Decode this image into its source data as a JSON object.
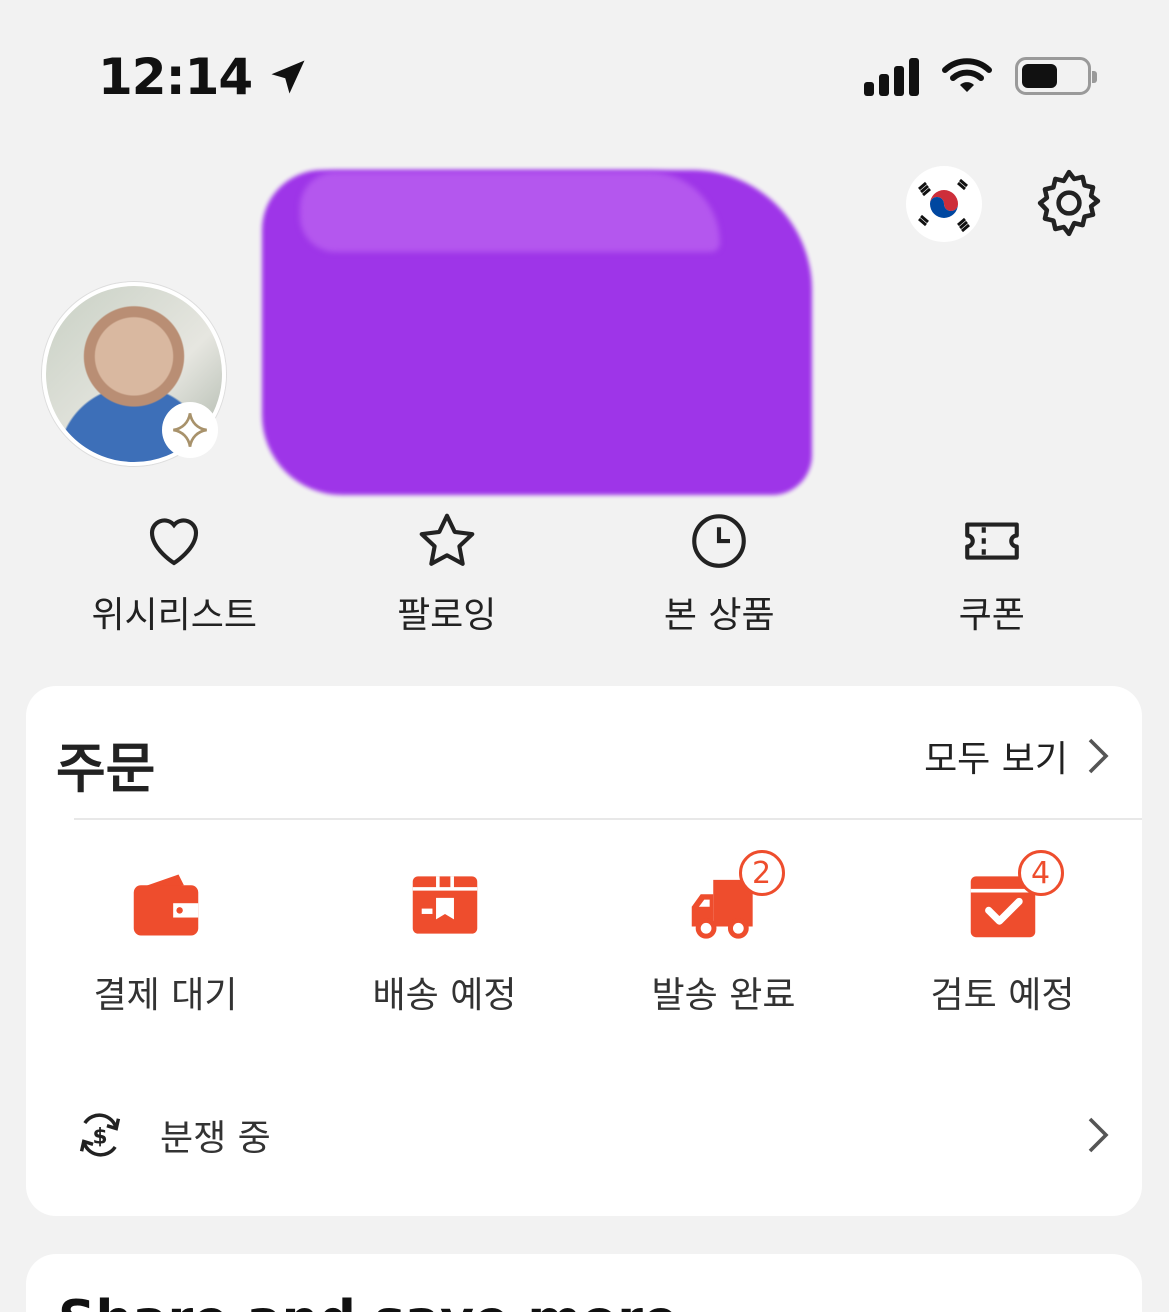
{
  "status_bar": {
    "time": "12:14"
  },
  "header": {
    "flag_icon": "korea-flag-icon",
    "settings_icon": "gear-icon"
  },
  "quick_links": [
    {
      "label": "위시리스트",
      "icon": "heart-icon"
    },
    {
      "label": "팔로잉",
      "icon": "star-icon"
    },
    {
      "label": "본 상품",
      "icon": "clock-icon"
    },
    {
      "label": "쿠폰",
      "icon": "ticket-icon"
    }
  ],
  "orders": {
    "title": "주문",
    "view_all": "모두 보기",
    "items": [
      {
        "label": "결제 대기",
        "icon": "wallet-icon",
        "badge": ""
      },
      {
        "label": "배송 예정",
        "icon": "box-icon",
        "badge": ""
      },
      {
        "label": "발송 완료",
        "icon": "truck-icon",
        "badge": "2"
      },
      {
        "label": "검토 예정",
        "icon": "review-check-icon",
        "badge": "4"
      }
    ],
    "dispute_label": "분쟁 중"
  },
  "next_section": {
    "title": "Share and save more"
  },
  "colors": {
    "accent": "#ee4d2d",
    "background": "#f2f2f2",
    "redaction": "#9a2be8"
  }
}
